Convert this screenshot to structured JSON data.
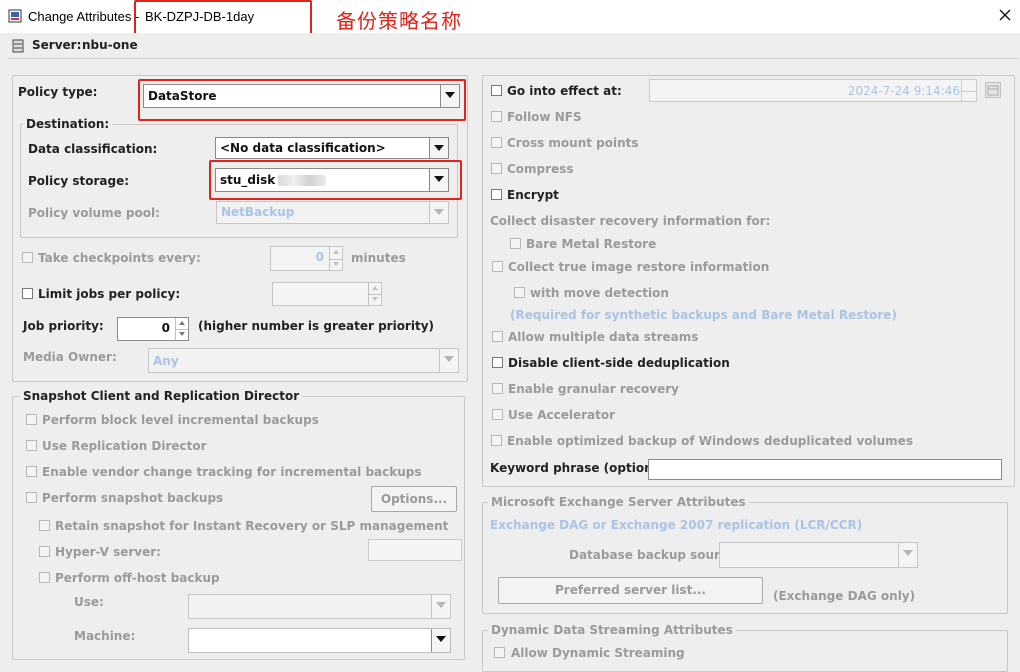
{
  "window": {
    "title_prefix": "Change Attributes -",
    "policy_name": "BK-DZPJ-DB-1day",
    "annotation": "备份策略名称",
    "server_label": "Server:",
    "server_name": "nbu-one"
  },
  "left": {
    "policy_type_label": "Policy type:",
    "policy_type_value": "DataStore",
    "destination_label": "Destination:",
    "data_classification_label": "Data classification:",
    "data_classification_value": "<No data classification>",
    "policy_storage_label": "Policy storage:",
    "policy_storage_value": "stu_disk",
    "policy_volume_pool_label": "Policy volume pool:",
    "policy_volume_pool_value": "NetBackup",
    "take_checkpoints_label": "Take checkpoints every:",
    "take_checkpoints_value": "0",
    "minutes_label": "minutes",
    "limit_jobs_label": "Limit jobs per policy:",
    "job_priority_label": "Job priority:",
    "job_priority_value": "0",
    "job_priority_hint": "(higher number is greater priority)",
    "media_owner_label": "Media Owner:",
    "media_owner_value": "Any"
  },
  "snapshot": {
    "group_label": "Snapshot Client and Replication Director",
    "block_level": "Perform block level incremental backups",
    "replication_director": "Use Replication Director",
    "vendor_tracking": "Enable vendor change tracking for incremental backups",
    "snapshot_backups": "Perform snapshot backups",
    "options_button": "Options...",
    "retain_snapshot": "Retain snapshot for Instant Recovery or SLP management",
    "hyperv": "Hyper-V server:",
    "offhost": "Perform off-host backup",
    "use_label": "Use:",
    "machine_label": "Machine:"
  },
  "right": {
    "go_into_effect": "Go into effect at:",
    "go_into_effect_value": "2024-7-24 9:14:46",
    "follow_nfs": "Follow NFS",
    "cross_mount": "Cross mount points",
    "compress": "Compress",
    "encrypt": "Encrypt",
    "collect_dr": "Collect disaster recovery information for:",
    "bare_metal": "Bare Metal Restore",
    "collect_tir": "Collect true image restore information",
    "move_detection": "with move detection",
    "required_note": "(Required for synthetic backups and Bare Metal Restore)",
    "multiple_streams": "Allow multiple data streams",
    "disable_dedup": "Disable client-side deduplication",
    "granular": "Enable granular recovery",
    "accelerator": "Use Accelerator",
    "optimized_backup": "Enable optimized backup of Windows deduplicated volumes",
    "keyword_label": "Keyword phrase (optional):",
    "keyword_value": ""
  },
  "exchange": {
    "group_label": "Microsoft Exchange Server Attributes",
    "dag_note": "Exchange DAG or Exchange 2007 replication (LCR/CCR)",
    "db_source_label": "Database backup source:",
    "preferred_button": "Preferred server list...",
    "dag_only": "(Exchange DAG only)"
  },
  "dynamic": {
    "group_label": "Dynamic Data Streaming Attributes",
    "allow_label": "Allow Dynamic Streaming"
  },
  "colors": {
    "annotation_red": "#e0241b",
    "disabled_blue": "#a9c4e6",
    "disabled_gray": "#9a9a9a"
  }
}
